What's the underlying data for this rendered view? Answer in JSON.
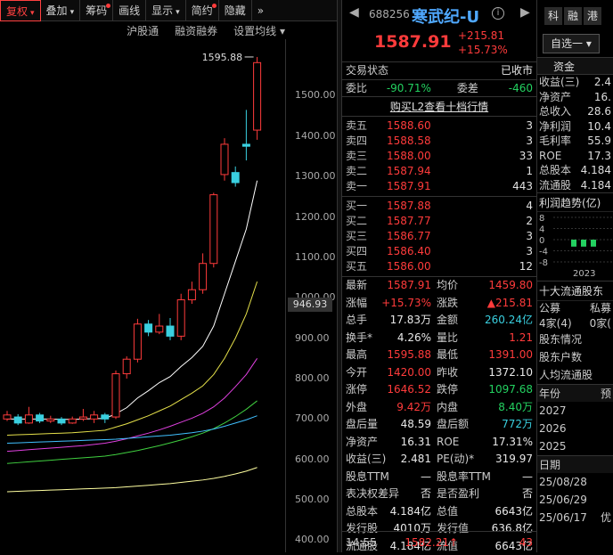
{
  "toolbar": {
    "items": [
      {
        "label": "复权",
        "dropdown": true,
        "active": true
      },
      {
        "label": "叠加",
        "dropdown": true
      },
      {
        "label": "筹码",
        "dot": true
      },
      {
        "label": "画线"
      },
      {
        "label": "显示",
        "dropdown": true
      },
      {
        "label": "简约",
        "dot": true
      },
      {
        "label": "隐藏"
      }
    ],
    "more_icon": "double-chevron-right-icon"
  },
  "subbar": {
    "hgt": "沪股通",
    "margin": "融资融券",
    "ma_setting": "设置均线 ▾"
  },
  "chart": {
    "high_label": "1595.88",
    "current_price_tag": "946.93",
    "y_ticks": [
      "1500.00",
      "1400.00",
      "1300.00",
      "1200.00",
      "1100.00",
      "1000.00",
      "900.00",
      "800.00",
      "700.00",
      "600.00",
      "500.00",
      "400.00"
    ],
    "colors": {
      "up": "#ff3b3b",
      "down": "#3ad0e0"
    }
  },
  "chart_data": {
    "type": "candlestick",
    "ylim": [
      370,
      1640
    ],
    "candles": [
      {
        "o": 700,
        "c": 710,
        "h": 720,
        "l": 695
      },
      {
        "o": 705,
        "c": 690,
        "h": 712,
        "l": 685
      },
      {
        "o": 690,
        "c": 710,
        "h": 730,
        "l": 688
      },
      {
        "o": 710,
        "c": 695,
        "h": 715,
        "l": 690
      },
      {
        "o": 695,
        "c": 700,
        "h": 708,
        "l": 690
      },
      {
        "o": 700,
        "c": 690,
        "h": 705,
        "l": 685
      },
      {
        "o": 690,
        "c": 700,
        "h": 706,
        "l": 688
      },
      {
        "o": 700,
        "c": 705,
        "h": 725,
        "l": 695
      },
      {
        "o": 700,
        "c": 710,
        "h": 720,
        "l": 690
      },
      {
        "o": 710,
        "c": 700,
        "h": 715,
        "l": 690
      },
      {
        "o": 705,
        "c": 812,
        "h": 820,
        "l": 700
      },
      {
        "o": 812,
        "c": 848,
        "h": 855,
        "l": 800
      },
      {
        "o": 848,
        "c": 935,
        "h": 948,
        "l": 840
      },
      {
        "o": 935,
        "c": 915,
        "h": 945,
        "l": 905
      },
      {
        "o": 915,
        "c": 930,
        "h": 960,
        "l": 910
      },
      {
        "o": 930,
        "c": 905,
        "h": 950,
        "l": 895
      },
      {
        "o": 905,
        "c": 995,
        "h": 1010,
        "l": 895
      },
      {
        "o": 995,
        "c": 1020,
        "h": 1040,
        "l": 985
      },
      {
        "o": 1020,
        "c": 1085,
        "h": 1110,
        "l": 1010
      },
      {
        "o": 1085,
        "c": 1255,
        "h": 1260,
        "l": 1075
      },
      {
        "o": 1305,
        "c": 1380,
        "h": 1395,
        "l": 1290
      },
      {
        "o": 1310,
        "c": 1285,
        "h": 1325,
        "l": 1275
      },
      {
        "o": 1380,
        "c": 1375,
        "h": 1465,
        "l": 1340
      },
      {
        "o": 1415,
        "c": 1582,
        "h": 1596,
        "l": 1391
      }
    ],
    "ma": [
      {
        "color": "#ffffff",
        "values": [
          700,
          700,
          700,
          700,
          700,
          699,
          699,
          700,
          701,
          701,
          713,
          728,
          752,
          770,
          790,
          805,
          830,
          852,
          880,
          930,
          1010,
          1090,
          1170,
          1290
        ]
      },
      {
        "color": "#e5e04a",
        "values": [
          660,
          661,
          662,
          663,
          664,
          665,
          666,
          668,
          670,
          672,
          680,
          688,
          698,
          708,
          720,
          732,
          748,
          764,
          782,
          810,
          850,
          900,
          960,
          1040
        ]
      },
      {
        "color": "#e040e0",
        "values": [
          620,
          622,
          624,
          626,
          628,
          630,
          632,
          634,
          637,
          640,
          645,
          651,
          658,
          665,
          673,
          682,
          692,
          702,
          714,
          730,
          752,
          780,
          810,
          850
        ]
      },
      {
        "color": "#40d040",
        "values": [
          590,
          592,
          594,
          596,
          598,
          600,
          602,
          604,
          606,
          608,
          612,
          617,
          622,
          628,
          634,
          641,
          648,
          656,
          665,
          676,
          690,
          706,
          724,
          745
        ]
      },
      {
        "color": "#40c0ff",
        "values": [
          640,
          641,
          642,
          643,
          644,
          645,
          646,
          647,
          648,
          649,
          650,
          652,
          654,
          656,
          658,
          660,
          663,
          666,
          670,
          675,
          682,
          690,
          698,
          708
        ]
      },
      {
        "color": "#ffffa0",
        "values": [
          520,
          521,
          522,
          523,
          524,
          525,
          526,
          527,
          528,
          529,
          530,
          532,
          534,
          536,
          538,
          540,
          543,
          546,
          549,
          553,
          558,
          564,
          571,
          580
        ]
      }
    ]
  },
  "quote": {
    "code": "688256",
    "name": "寒武纪-U",
    "price": "1587.91",
    "change": "+215.81",
    "change_pct": "+15.73%",
    "status_label": "交易状态",
    "status_value": "已收市",
    "ratio_label": "委比",
    "ratio_value": "-90.71%",
    "diff_label": "委差",
    "diff_value": "-460",
    "l2_link": "购买L2查看十档行情",
    "asks": [
      {
        "label": "卖五",
        "price": "1588.60",
        "vol": "3"
      },
      {
        "label": "卖四",
        "price": "1588.58",
        "vol": "3"
      },
      {
        "label": "卖三",
        "price": "1588.00",
        "vol": "33"
      },
      {
        "label": "卖二",
        "price": "1587.94",
        "vol": "1"
      },
      {
        "label": "卖一",
        "price": "1587.91",
        "vol": "443"
      }
    ],
    "bids": [
      {
        "label": "买一",
        "price": "1587.88",
        "vol": "4"
      },
      {
        "label": "买二",
        "price": "1587.77",
        "vol": "2"
      },
      {
        "label": "买三",
        "price": "1586.77",
        "vol": "3"
      },
      {
        "label": "买四",
        "price": "1586.40",
        "vol": "3"
      },
      {
        "label": "买五",
        "price": "1586.00",
        "vol": "12"
      }
    ],
    "stats": [
      {
        "k1": "最新",
        "v1": "1587.91",
        "c1": "red",
        "k2": "均价",
        "v2": "1459.80",
        "c2": "red"
      },
      {
        "k1": "涨幅",
        "v1": "+15.73%",
        "c1": "red",
        "k2": "涨跌",
        "v2": "▲215.81",
        "c2": "red"
      },
      {
        "k1": "总手",
        "v1": "17.83万",
        "c1": "white",
        "k2": "金额",
        "v2": "260.24亿",
        "c2": "cyan"
      },
      {
        "k1": "换手*",
        "v1": "4.26%",
        "c1": "white",
        "k2": "量比",
        "v2": "1.21",
        "c2": "red"
      },
      {
        "k1": "最高",
        "v1": "1595.88",
        "c1": "red",
        "k2": "最低",
        "v2": "1391.00",
        "c2": "red"
      },
      {
        "k1": "今开",
        "v1": "1420.00",
        "c1": "red",
        "k2": "昨收",
        "v2": "1372.10",
        "c2": "white"
      },
      {
        "k1": "涨停",
        "v1": "1646.52",
        "c1": "red",
        "k2": "跌停",
        "v2": "1097.68",
        "c2": "green"
      },
      {
        "k1": "外盘",
        "v1": "9.42万",
        "c1": "red",
        "k2": "内盘",
        "v2": "8.40万",
        "c2": "green"
      },
      {
        "k1": "盘后量",
        "v1": "48.59",
        "c1": "white",
        "k2": "盘后额",
        "v2": "772万",
        "c2": "cyan"
      },
      {
        "k1": "净资产",
        "v1": "16.31",
        "c1": "white",
        "k2": "ROE",
        "v2": "17.31%",
        "c2": "white"
      },
      {
        "k1": "收益(三)",
        "v1": "2.481",
        "c1": "white",
        "k2": "PE(动)*",
        "v2": "319.97",
        "c2": "white"
      },
      {
        "k1": "股息TTM",
        "v1": "—",
        "c1": "white",
        "k2": "股息率TTM",
        "v2": "—",
        "c2": "white"
      },
      {
        "k1": "表决权差异",
        "v1": "否",
        "c1": "white",
        "k2": "是否盈利",
        "v2": "否",
        "c2": "white"
      },
      {
        "k1": "总股本",
        "v1": "4.184亿",
        "c1": "white",
        "k2": "总值",
        "v2": "6643亿",
        "c2": "white"
      },
      {
        "k1": "发行股",
        "v1": "4010万",
        "c1": "white",
        "k2": "发行值",
        "v2": "636.8亿",
        "c2": "white"
      },
      {
        "k1": "流通股",
        "v1": "4.184亿",
        "c1": "white",
        "k2": "流值",
        "v2": "6643亿",
        "c2": "white"
      }
    ],
    "tick": {
      "time": "14:55",
      "price": "1582.21",
      "arrow": "↑",
      "vol": "43"
    }
  },
  "side": {
    "tabs": [
      "科",
      "融",
      "港"
    ],
    "select_label": "自选一",
    "fund_header": "资金",
    "fin_rows": [
      {
        "k": "收益(三)",
        "v": "2.4"
      },
      {
        "k": "净资产",
        "v": "16."
      },
      {
        "k": "总收入",
        "v": "28.6"
      },
      {
        "k": "净利润",
        "v": "10.4"
      },
      {
        "k": "毛利率",
        "v": "55.9"
      },
      {
        "k": "ROE",
        "v": "17.3"
      },
      {
        "k": "总股本",
        "v": "4.184"
      },
      {
        "k": "流通股",
        "v": "4.184"
      }
    ],
    "trend_title": "利润趋势(亿)",
    "trend_ticks": [
      "8",
      "4",
      "0",
      "-4",
      "-8"
    ],
    "trend_year": "2023",
    "trend_values": [
      -2.5,
      -2.5,
      -2.5
    ],
    "holders_title": "十大流通股东",
    "holders_cols": [
      "公募",
      "私募"
    ],
    "holders_counts": [
      "4家(4)",
      "0家("
    ],
    "rows2": [
      "股东情况",
      "股东户数",
      "人均流通股"
    ],
    "year_head": [
      "年份",
      "预"
    ],
    "years": [
      "2027",
      "2026",
      "2025"
    ],
    "date_head": "日期",
    "dates": [
      "25/08/28",
      "25/06/29",
      "25/06/17"
    ],
    "last_extra": "优"
  }
}
